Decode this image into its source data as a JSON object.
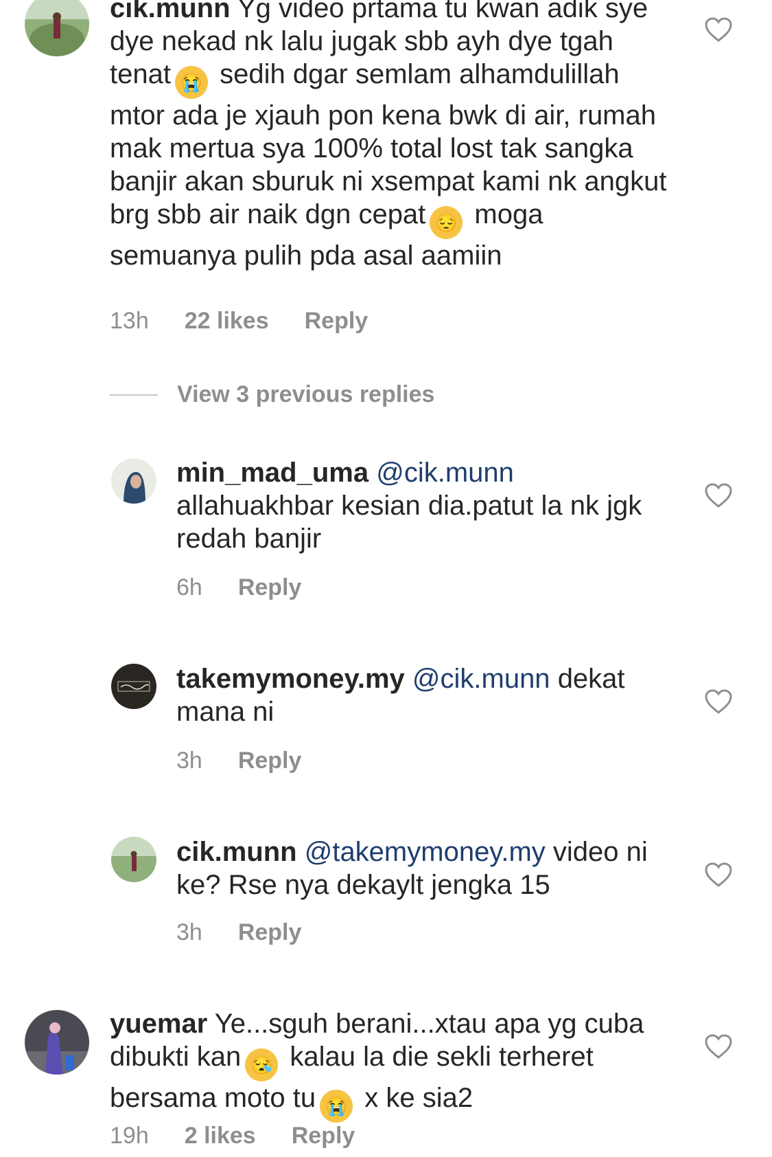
{
  "comments": [
    {
      "username": "cik.munn",
      "text_parts": [
        "Yg video prtama tu kwan adik sye dye nekad nk lalu jugak sbb ayh dye tgah tenat",
        " sedih dgar semlam alhamdulillah mtor ada je xjauh pon kena bwk di air, rumah mak mertua sya 100% total lost tak sangka banjir akan sburuk ni xsempat kami nk angkut brg sbb air naik dgn cepat",
        " moga semuanya pulih pda asal aamiin"
      ],
      "time": "13h",
      "likes": "22 likes",
      "reply": "Reply"
    },
    {
      "username": "yuemar",
      "text_parts": [
        "Ye...sguh berani...xtau apa yg cuba dibukti kan",
        " kalau la die sekli terheret bersama moto tu",
        " x ke sia2"
      ],
      "time": "19h",
      "likes": "2 likes",
      "reply": "Reply"
    }
  ],
  "view_replies": "View 3 previous replies",
  "replies": [
    {
      "username": "min_mad_uma",
      "mention": "@cik.munn",
      "text": "allahuakhbar kesian dia.patut la nk jgk redah banjir",
      "time": "6h",
      "reply": "Reply"
    },
    {
      "username": "takemymoney.my",
      "mention": "@cik.munn",
      "text": "dekat mana ni",
      "time": "3h",
      "reply": "Reply"
    },
    {
      "username": "cik.munn",
      "mention": "@takemymoney.my",
      "text": "video ni ke? Rse nya dekaylt jengka 15",
      "time": "3h",
      "reply": "Reply"
    }
  ],
  "emojis": {
    "crying": "😭",
    "pensive": "😔",
    "sleepy": "😪"
  },
  "colors": {
    "text": "#262626",
    "muted": "#8e8e8e",
    "mention": "#1f3e6e"
  }
}
